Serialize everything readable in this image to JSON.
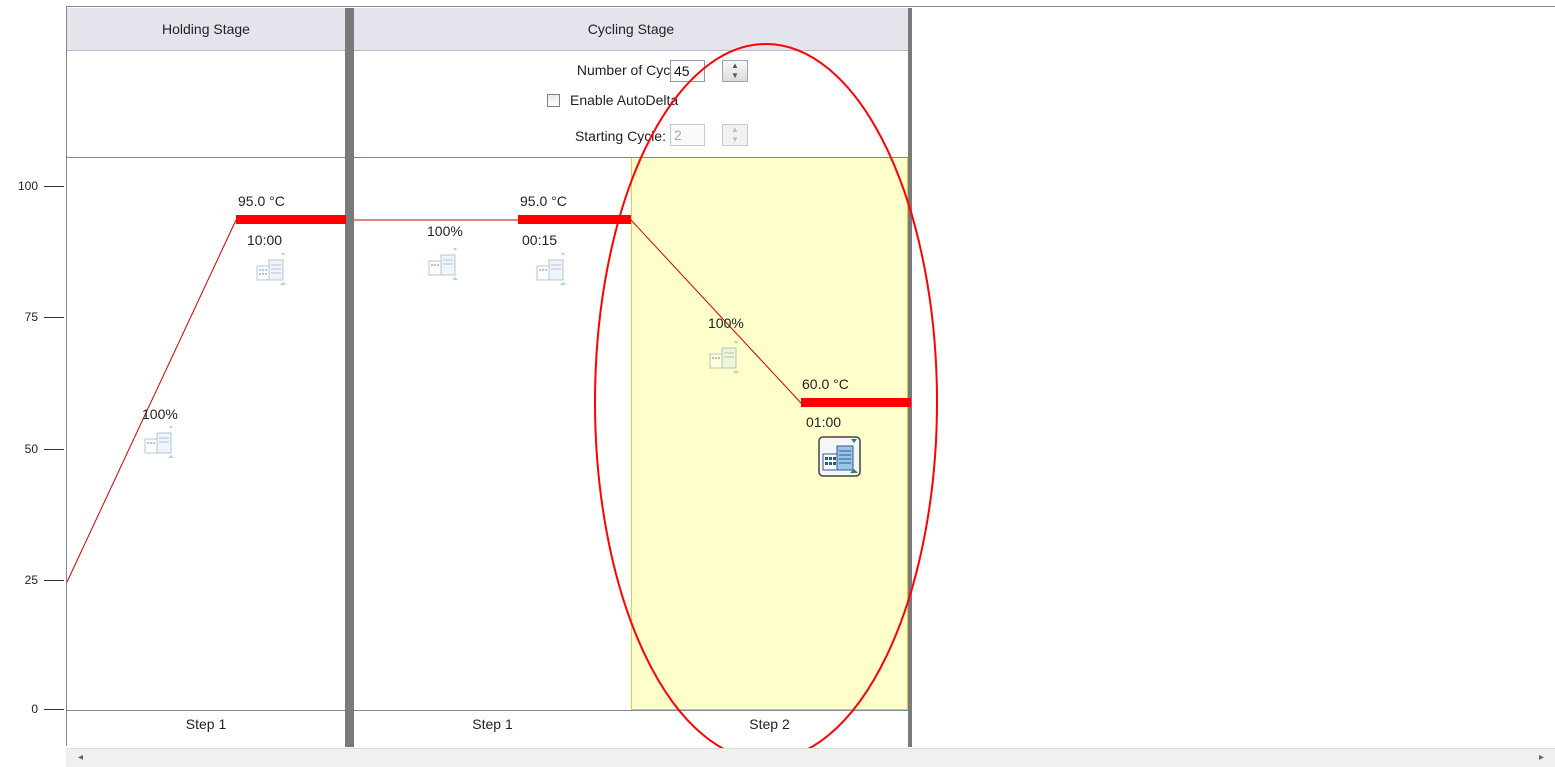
{
  "y_axis": {
    "ticks": [
      "100",
      "75",
      "50",
      "25",
      "0"
    ]
  },
  "stages": [
    {
      "name": "Holding Stage",
      "steps": [
        "Step 1"
      ]
    },
    {
      "name": "Cycling Stage",
      "steps": [
        "Step 1",
        "Step 2"
      ]
    }
  ],
  "cycling_controls": {
    "cycles_label": "Number of Cycles:",
    "cycles_value": "45",
    "autodelta_label": "Enable AutoDelta",
    "autodelta_checked": false,
    "starting_cycle_label": "Starting Cycle:",
    "starting_cycle_value": "2"
  },
  "steps": [
    {
      "temp": "95.0 °C",
      "time": "10:00",
      "ramp": "100%"
    },
    {
      "temp": "95.0 °C",
      "time": "00:15",
      "ramp": "100%"
    },
    {
      "temp": "60.0 °C",
      "time": "01:00",
      "ramp": "100%"
    }
  ],
  "selected_step": "Cycling Stage Step 2",
  "colors": {
    "hold_line": "#ff0000",
    "ramp_line": "#cc0000",
    "selected_bg": "#ffffcc",
    "annotation": "#ff0000"
  },
  "icons": {
    "data_collection": "data-collection-icon",
    "scroll_left": "scroll-left-arrow",
    "scroll_right": "scroll-right-arrow"
  }
}
